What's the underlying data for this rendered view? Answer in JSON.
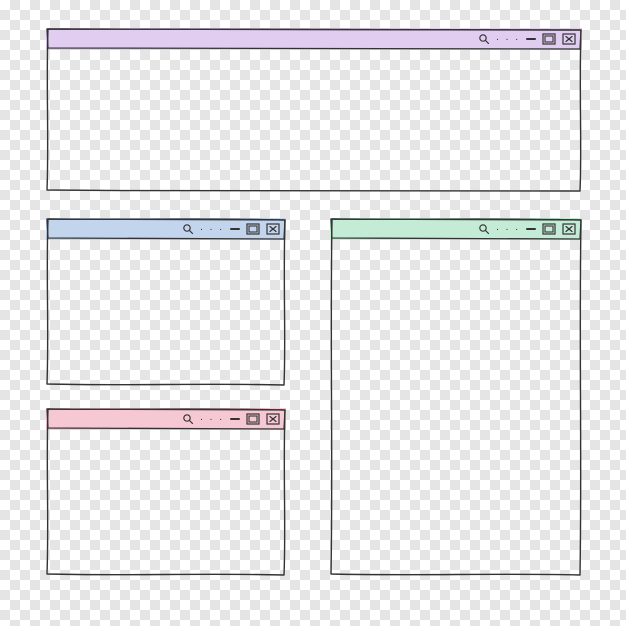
{
  "windows": [
    {
      "id": "top",
      "titlebar_color": "#e1cdf0",
      "search_icon": "search-icon",
      "menu_icon": "menu-dots-icon",
      "minimize_icon": "minimize-icon",
      "maximize_icon": "maximize-icon",
      "close_icon": "close-icon"
    },
    {
      "id": "blue",
      "titlebar_color": "#c3d4ed",
      "search_icon": "search-icon",
      "menu_icon": "menu-dots-icon",
      "minimize_icon": "minimize-icon",
      "maximize_icon": "maximize-icon",
      "close_icon": "close-icon"
    },
    {
      "id": "pink",
      "titlebar_color": "#f5c8d3",
      "search_icon": "search-icon",
      "menu_icon": "menu-dots-icon",
      "minimize_icon": "minimize-icon",
      "maximize_icon": "maximize-icon",
      "close_icon": "close-icon"
    },
    {
      "id": "green",
      "titlebar_color": "#c4ebd6",
      "search_icon": "search-icon",
      "menu_icon": "menu-dots-icon",
      "minimize_icon": "minimize-icon",
      "maximize_icon": "maximize-icon",
      "close_icon": "close-icon"
    }
  ],
  "labels": {
    "dots": ". . ."
  }
}
